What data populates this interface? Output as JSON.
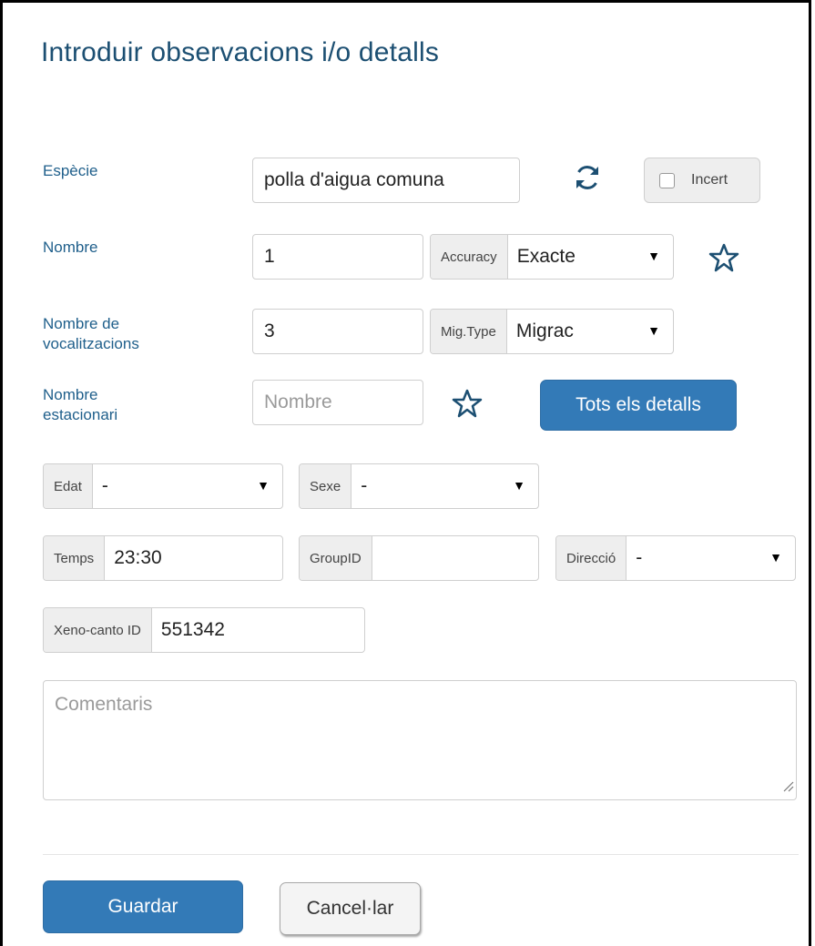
{
  "dialog": {
    "title": "Introduir observacions i/o detalls"
  },
  "especie": {
    "label": "Espècie",
    "value": "polla d'aigua comuna",
    "refresh_icon": "refresh-icon",
    "uncertain_label": "Incert",
    "uncertain_checked": false
  },
  "nombre": {
    "label": "Nombre",
    "value": "1",
    "accuracy_addon": "Accuracy",
    "accuracy_value": "Exacte",
    "star_icon": "star-icon"
  },
  "vocalitzacions": {
    "label_line1": "Nombre de",
    "label_line2": "vocalitzacions",
    "value": "3",
    "migtype_addon": "Mig.Type",
    "migtype_value": "Migrac"
  },
  "estacionari": {
    "label_line1": "Nombre",
    "label_line2": "estacionari",
    "placeholder": "Nombre",
    "star_icon": "star-icon",
    "details_button": "Tots els detalls"
  },
  "edat": {
    "addon": "Edat",
    "value": "-"
  },
  "sexe": {
    "addon": "Sexe",
    "value": "-"
  },
  "temps": {
    "addon": "Temps",
    "value": "23:30"
  },
  "groupid": {
    "addon": "GroupID",
    "value": ""
  },
  "direccio": {
    "addon": "Direcció",
    "value": "-"
  },
  "xenocanto": {
    "addon": "Xeno-canto ID",
    "value": "551342"
  },
  "comentaris": {
    "placeholder": "Comentaris"
  },
  "footer": {
    "save_label": "Guardar",
    "cancel_label": "Cancel·lar"
  },
  "colors": {
    "primary": "#337ab7",
    "title": "#1c4f72",
    "label": "#1f5f8b"
  }
}
